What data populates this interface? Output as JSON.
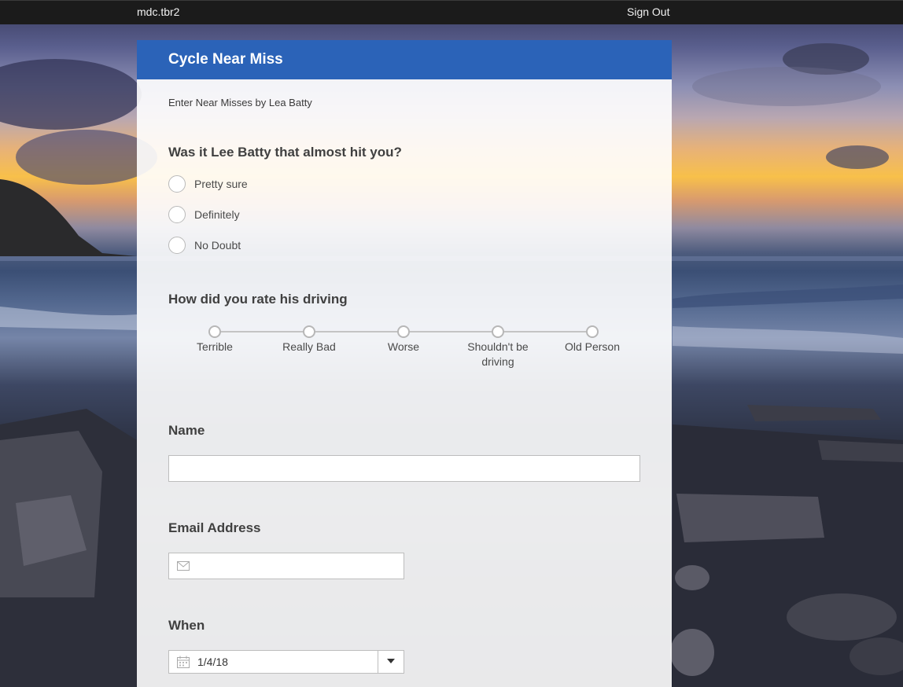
{
  "topbar": {
    "user": "mdc.tbr2",
    "signout_label": "Sign Out"
  },
  "form": {
    "title": "Cycle Near Miss",
    "subtitle": "Enter Near Misses by Lea Batty",
    "header_color": "#2b63b8",
    "q1": {
      "label": "Was it Lee Batty that almost hit you?",
      "options": [
        "Pretty sure",
        "Definitely",
        "No Doubt"
      ]
    },
    "q2": {
      "label": "How did you rate his driving",
      "options": [
        "Terrible",
        "Really Bad",
        "Worse",
        "Shouldn't be driving",
        "Old Person"
      ]
    },
    "name": {
      "label": "Name",
      "value": ""
    },
    "email": {
      "label": "Email Address",
      "value": "",
      "icon": "mail-icon"
    },
    "when": {
      "label": "When",
      "value": "1/4/18",
      "icon": "calendar-icon"
    }
  }
}
